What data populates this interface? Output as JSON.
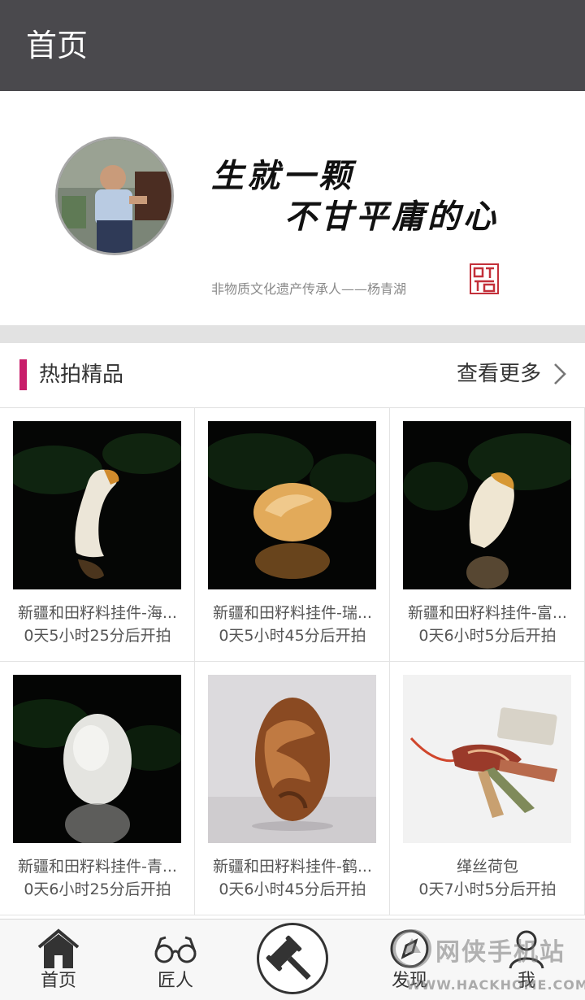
{
  "header": {
    "title": "首页"
  },
  "banner": {
    "calligraphy_line1": "生就一颗",
    "calligraphy_line2": "不甘平庸的心",
    "caption": "非物质文化遗产传承人——杨青湖"
  },
  "section": {
    "title": "热拍精品",
    "more_label": "查看更多"
  },
  "products": [
    {
      "name": "新疆和田籽料挂件-海...",
      "timer": "0天5小时25分后开拍"
    },
    {
      "name": "新疆和田籽料挂件-瑞...",
      "timer": "0天5小时45分后开拍"
    },
    {
      "name": "新疆和田籽料挂件-富...",
      "timer": "0天6小时5分后开拍"
    },
    {
      "name": "新疆和田籽料挂件-青...",
      "timer": "0天6小时25分后开拍"
    },
    {
      "name": "新疆和田籽料挂件-鹤...",
      "timer": "0天6小时45分后开拍"
    },
    {
      "name": "缂丝荷包",
      "timer": "0天7小时5分后开拍"
    }
  ],
  "tabbar": {
    "home": "首页",
    "craftsmen": "匠人",
    "discover": "发现",
    "me": "我"
  },
  "icons": {
    "home": "home-icon",
    "craftsmen": "glasses-icon",
    "auction": "gavel-icon",
    "discover": "compass-icon",
    "me": "user-icon",
    "more": "chevron-right-icon"
  },
  "colors": {
    "header_bg": "#4a494d",
    "accent": "#c81e6a",
    "divider": "#e2e2e2"
  },
  "watermark": {
    "brand": "网侠手机站",
    "url": "WWW.HACKHOME.COM"
  }
}
